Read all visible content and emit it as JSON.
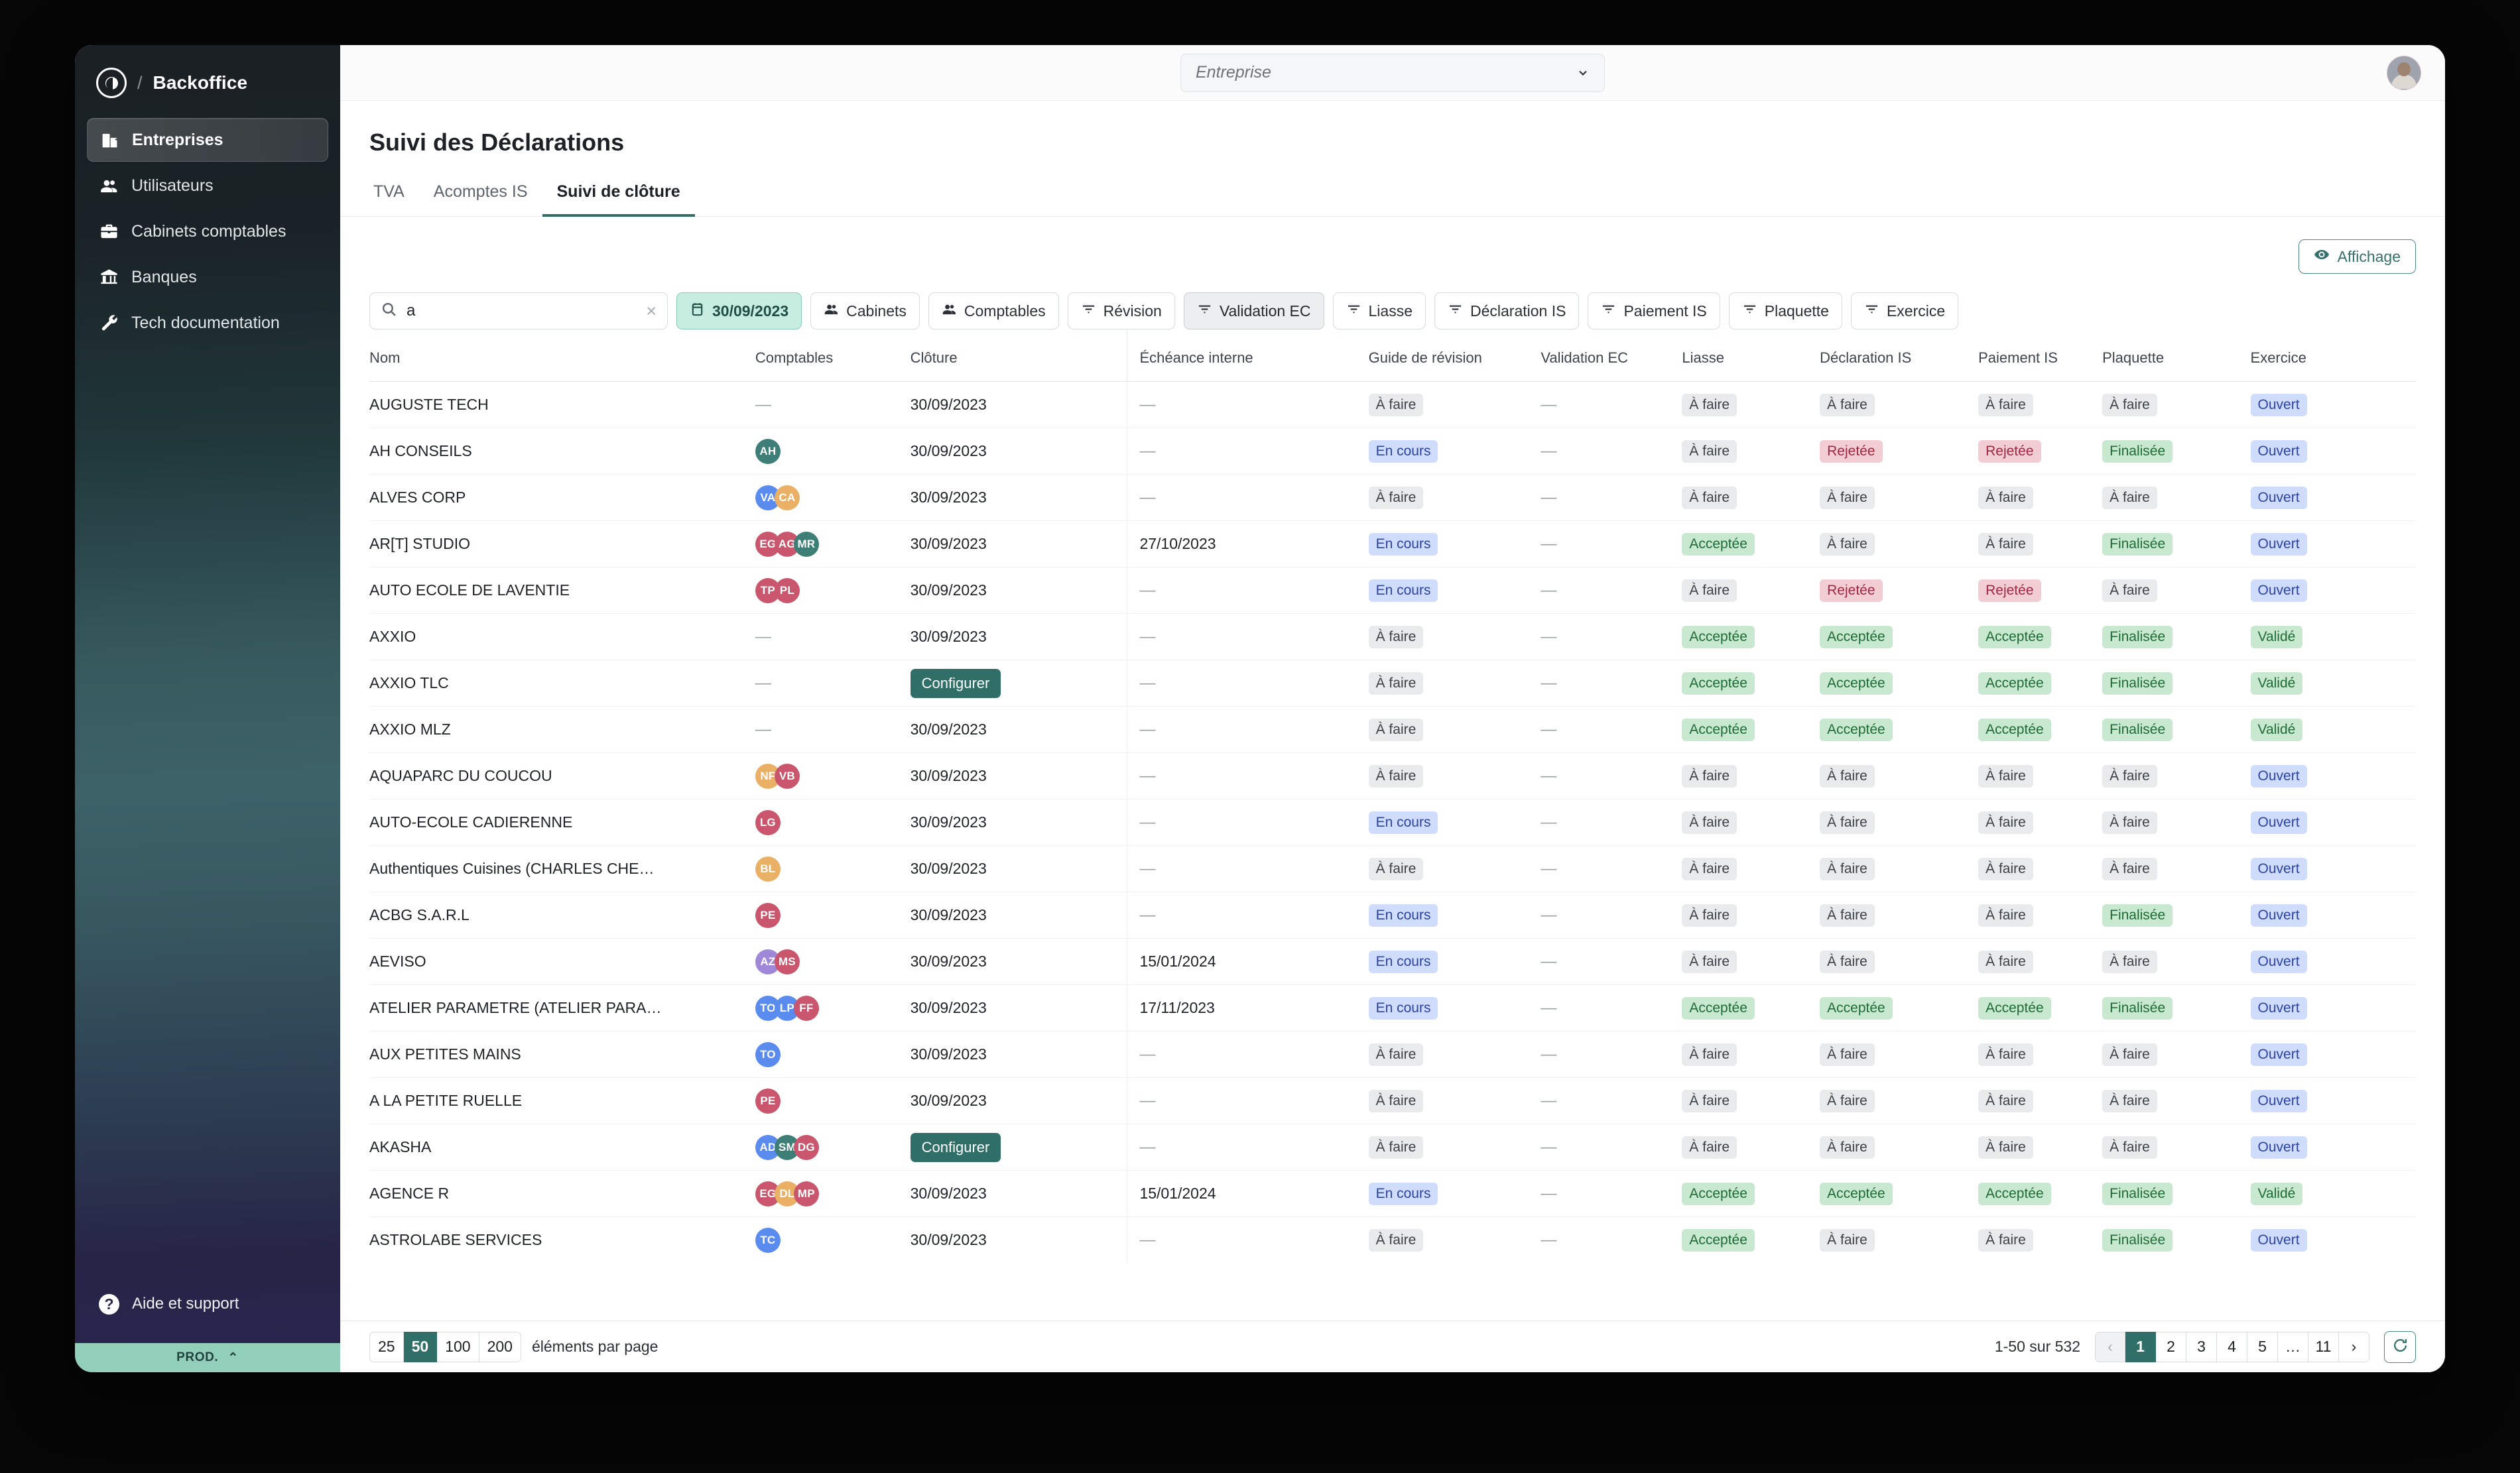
{
  "sidebar": {
    "brand": {
      "slash": "/",
      "name": "Backoffice",
      "logo_icon": "circle-contrast-logo"
    },
    "items": [
      {
        "label": "Entreprises",
        "icon": "building-icon",
        "active": true
      },
      {
        "label": "Utilisateurs",
        "icon": "users-icon",
        "active": false
      },
      {
        "label": "Cabinets comptables",
        "icon": "briefcase-icon",
        "active": false
      },
      {
        "label": "Banques",
        "icon": "bank-icon",
        "active": false
      },
      {
        "label": "Tech documentation",
        "icon": "wrench-icon",
        "active": false
      }
    ],
    "help": {
      "label": "Aide et support",
      "icon": "question-circle-icon"
    },
    "env": {
      "label": "PROD.",
      "caret": "chevron-up-icon"
    }
  },
  "topbar": {
    "entreprise_select": {
      "placeholder": "Entreprise",
      "value": ""
    },
    "avatar": "user-photo-avatar"
  },
  "page": {
    "title": "Suivi des Déclarations",
    "tabs": [
      {
        "label": "TVA",
        "active": false
      },
      {
        "label": "Acomptes IS",
        "active": false
      },
      {
        "label": "Suivi de clôture",
        "active": true
      }
    ],
    "affichage_button": {
      "label": "Affichage",
      "icon": "eye-icon"
    }
  },
  "filters": {
    "search": {
      "value": "a",
      "placeholder": "",
      "icon": "search-icon",
      "clear": "×"
    },
    "chips": [
      {
        "label": "30/09/2023",
        "icon": "calendar-icon",
        "state": "date"
      },
      {
        "label": "Cabinets",
        "icon": "users-icon",
        "state": "default"
      },
      {
        "label": "Comptables",
        "icon": "users-icon",
        "state": "default"
      },
      {
        "label": "Révision",
        "icon": "filter-icon",
        "state": "default"
      },
      {
        "label": "Validation EC",
        "icon": "filter-icon",
        "state": "selected"
      },
      {
        "label": "Liasse",
        "icon": "filter-icon",
        "state": "default"
      },
      {
        "label": "Déclaration IS",
        "icon": "filter-icon",
        "state": "default"
      },
      {
        "label": "Paiement IS",
        "icon": "filter-icon",
        "state": "default"
      },
      {
        "label": "Plaquette",
        "icon": "filter-icon",
        "state": "default"
      },
      {
        "label": "Exercice",
        "icon": "filter-icon",
        "state": "default"
      }
    ]
  },
  "table": {
    "columns": [
      "Nom",
      "Comptables",
      "Clôture",
      "Échéance interne",
      "Guide de révision",
      "Validation EC",
      "Liasse",
      "Déclaration IS",
      "Paiement IS",
      "Plaquette",
      "Exercice"
    ],
    "avatar_colors": {
      "teal": "#3d7f76",
      "blue": "#5a8cf0",
      "orange": "#e9b066",
      "red": "#c9566c",
      "purple": "#a088d8"
    },
    "rows": [
      {
        "nom": "AUGUSTE TECH",
        "comptables": [],
        "cloture": "30/09/2023",
        "cloture_button": false,
        "echeance": "—",
        "revision": "À faire",
        "validation_ec": "—",
        "liasse": "À faire",
        "declaration_is": "À faire",
        "paiement_is": "À faire",
        "plaquette": "À faire",
        "exercice": "Ouvert"
      },
      {
        "nom": "AH CONSEILS",
        "comptables": [
          {
            "initials": "AH",
            "color": "teal"
          }
        ],
        "cloture": "30/09/2023",
        "cloture_button": false,
        "echeance": "—",
        "revision": "En cours",
        "validation_ec": "—",
        "liasse": "À faire",
        "declaration_is": "Rejetée",
        "paiement_is": "Rejetée",
        "plaquette": "Finalisée",
        "exercice": "Ouvert"
      },
      {
        "nom": "ALVES CORP",
        "comptables": [
          {
            "initials": "VA",
            "color": "blue"
          },
          {
            "initials": "CA",
            "color": "orange"
          }
        ],
        "cloture": "30/09/2023",
        "cloture_button": false,
        "echeance": "—",
        "revision": "À faire",
        "validation_ec": "—",
        "liasse": "À faire",
        "declaration_is": "À faire",
        "paiement_is": "À faire",
        "plaquette": "À faire",
        "exercice": "Ouvert"
      },
      {
        "nom": "AR[T] STUDIO",
        "comptables": [
          {
            "initials": "EG",
            "color": "red"
          },
          {
            "initials": "AG",
            "color": "red"
          },
          {
            "initials": "MR",
            "color": "teal"
          }
        ],
        "cloture": "30/09/2023",
        "cloture_button": false,
        "echeance": "27/10/2023",
        "revision": "En cours",
        "validation_ec": "—",
        "liasse": "Acceptée",
        "declaration_is": "À faire",
        "paiement_is": "À faire",
        "plaquette": "Finalisée",
        "exercice": "Ouvert"
      },
      {
        "nom": "AUTO ECOLE DE LAVENTIE",
        "comptables": [
          {
            "initials": "TP",
            "color": "red"
          },
          {
            "initials": "PL",
            "color": "red"
          }
        ],
        "cloture": "30/09/2023",
        "cloture_button": false,
        "echeance": "—",
        "revision": "En cours",
        "validation_ec": "—",
        "liasse": "À faire",
        "declaration_is": "Rejetée",
        "paiement_is": "Rejetée",
        "plaquette": "À faire",
        "exercice": "Ouvert"
      },
      {
        "nom": "AXXIO",
        "comptables": [],
        "cloture": "30/09/2023",
        "cloture_button": false,
        "echeance": "—",
        "revision": "À faire",
        "validation_ec": "—",
        "liasse": "Acceptée",
        "declaration_is": "Acceptée",
        "paiement_is": "Acceptée",
        "plaquette": "Finalisée",
        "exercice": "Validé"
      },
      {
        "nom": "AXXIO TLC",
        "comptables": [],
        "cloture": "Configurer",
        "cloture_button": true,
        "echeance": "—",
        "revision": "À faire",
        "validation_ec": "—",
        "liasse": "Acceptée",
        "declaration_is": "Acceptée",
        "paiement_is": "Acceptée",
        "plaquette": "Finalisée",
        "exercice": "Validé"
      },
      {
        "nom": "AXXIO MLZ",
        "comptables": [],
        "cloture": "30/09/2023",
        "cloture_button": false,
        "echeance": "—",
        "revision": "À faire",
        "validation_ec": "—",
        "liasse": "Acceptée",
        "declaration_is": "Acceptée",
        "paiement_is": "Acceptée",
        "plaquette": "Finalisée",
        "exercice": "Validé"
      },
      {
        "nom": "AQUAPARC DU COUCOU",
        "comptables": [
          {
            "initials": "NF",
            "color": "orange"
          },
          {
            "initials": "VB",
            "color": "red"
          }
        ],
        "cloture": "30/09/2023",
        "cloture_button": false,
        "echeance": "—",
        "revision": "À faire",
        "validation_ec": "—",
        "liasse": "À faire",
        "declaration_is": "À faire",
        "paiement_is": "À faire",
        "plaquette": "À faire",
        "exercice": "Ouvert"
      },
      {
        "nom": "AUTO-ECOLE CADIERENNE",
        "comptables": [
          {
            "initials": "LG",
            "color": "red"
          }
        ],
        "cloture": "30/09/2023",
        "cloture_button": false,
        "echeance": "—",
        "revision": "En cours",
        "validation_ec": "—",
        "liasse": "À faire",
        "declaration_is": "À faire",
        "paiement_is": "À faire",
        "plaquette": "À faire",
        "exercice": "Ouvert"
      },
      {
        "nom": "Authentiques Cuisines (CHARLES CHE…",
        "comptables": [
          {
            "initials": "BL",
            "color": "orange"
          }
        ],
        "cloture": "30/09/2023",
        "cloture_button": false,
        "echeance": "—",
        "revision": "À faire",
        "validation_ec": "—",
        "liasse": "À faire",
        "declaration_is": "À faire",
        "paiement_is": "À faire",
        "plaquette": "À faire",
        "exercice": "Ouvert"
      },
      {
        "nom": "ACBG S.A.R.L",
        "comptables": [
          {
            "initials": "PE",
            "color": "red"
          }
        ],
        "cloture": "30/09/2023",
        "cloture_button": false,
        "echeance": "—",
        "revision": "En cours",
        "validation_ec": "—",
        "liasse": "À faire",
        "declaration_is": "À faire",
        "paiement_is": "À faire",
        "plaquette": "Finalisée",
        "exercice": "Ouvert"
      },
      {
        "nom": "AEVISO",
        "comptables": [
          {
            "initials": "AZ",
            "color": "purple"
          },
          {
            "initials": "MS",
            "color": "red"
          }
        ],
        "cloture": "30/09/2023",
        "cloture_button": false,
        "echeance": "15/01/2024",
        "revision": "En cours",
        "validation_ec": "—",
        "liasse": "À faire",
        "declaration_is": "À faire",
        "paiement_is": "À faire",
        "plaquette": "À faire",
        "exercice": "Ouvert"
      },
      {
        "nom": "ATELIER PARAMETRE (ATELIER PARA…",
        "comptables": [
          {
            "initials": "TO",
            "color": "blue"
          },
          {
            "initials": "LP",
            "color": "blue"
          },
          {
            "initials": "FF",
            "color": "red"
          }
        ],
        "cloture": "30/09/2023",
        "cloture_button": false,
        "echeance": "17/11/2023",
        "revision": "En cours",
        "validation_ec": "—",
        "liasse": "Acceptée",
        "declaration_is": "Acceptée",
        "paiement_is": "Acceptée",
        "plaquette": "Finalisée",
        "exercice": "Ouvert"
      },
      {
        "nom": "AUX PETITES MAINS",
        "comptables": [
          {
            "initials": "TO",
            "color": "blue"
          }
        ],
        "cloture": "30/09/2023",
        "cloture_button": false,
        "echeance": "—",
        "revision": "À faire",
        "validation_ec": "—",
        "liasse": "À faire",
        "declaration_is": "À faire",
        "paiement_is": "À faire",
        "plaquette": "À faire",
        "exercice": "Ouvert"
      },
      {
        "nom": "A LA PETITE RUELLE",
        "comptables": [
          {
            "initials": "PE",
            "color": "red"
          }
        ],
        "cloture": "30/09/2023",
        "cloture_button": false,
        "echeance": "—",
        "revision": "À faire",
        "validation_ec": "—",
        "liasse": "À faire",
        "declaration_is": "À faire",
        "paiement_is": "À faire",
        "plaquette": "À faire",
        "exercice": "Ouvert"
      },
      {
        "nom": "AKASHA",
        "comptables": [
          {
            "initials": "AD",
            "color": "blue"
          },
          {
            "initials": "SM",
            "color": "teal"
          },
          {
            "initials": "DG",
            "color": "red"
          }
        ],
        "cloture": "Configurer",
        "cloture_button": true,
        "echeance": "—",
        "revision": "À faire",
        "validation_ec": "—",
        "liasse": "À faire",
        "declaration_is": "À faire",
        "paiement_is": "À faire",
        "plaquette": "À faire",
        "exercice": "Ouvert"
      },
      {
        "nom": "AGENCE R",
        "comptables": [
          {
            "initials": "EG",
            "color": "red"
          },
          {
            "initials": "DL",
            "color": "orange"
          },
          {
            "initials": "MP",
            "color": "red"
          }
        ],
        "cloture": "30/09/2023",
        "cloture_button": false,
        "echeance": "15/01/2024",
        "revision": "En cours",
        "validation_ec": "—",
        "liasse": "Acceptée",
        "declaration_is": "Acceptée",
        "paiement_is": "Acceptée",
        "plaquette": "Finalisée",
        "exercice": "Validé"
      },
      {
        "nom": "ASTROLABE SERVICES",
        "comptables": [
          {
            "initials": "TC",
            "color": "blue"
          }
        ],
        "cloture": "30/09/2023",
        "cloture_button": false,
        "echeance": "—",
        "revision": "À faire",
        "validation_ec": "—",
        "liasse": "Acceptée",
        "declaration_is": "À faire",
        "paiement_is": "À faire",
        "plaquette": "Finalisée",
        "exercice": "Ouvert"
      }
    ]
  },
  "footer": {
    "per_page_options": [
      "25",
      "50",
      "100",
      "200"
    ],
    "per_page_selected": "50",
    "per_page_label": "éléments par page",
    "range": "1-50 sur 532",
    "pages": [
      "‹",
      "1",
      "2",
      "3",
      "4",
      "5",
      "…",
      "11",
      "›"
    ],
    "page_selected": "1",
    "refresh_icon": "refresh-icon"
  }
}
